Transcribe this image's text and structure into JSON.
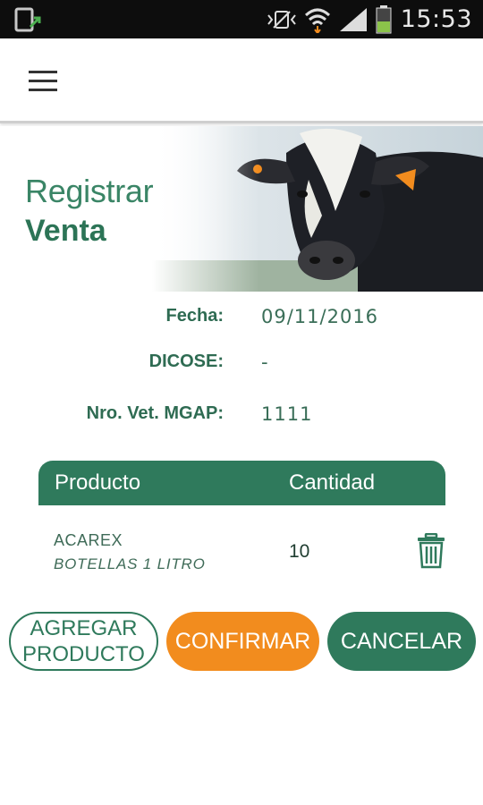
{
  "statusbar": {
    "time": "15:53"
  },
  "header": {
    "title_line1": "Registrar",
    "title_line2": "Venta"
  },
  "info": {
    "fecha_label": "Fecha:",
    "fecha_value": "09/11/2016",
    "dicose_label": "DICOSE:",
    "dicose_value": "-",
    "vet_label": "Nro. Vet. MGAP:",
    "vet_value": "1111"
  },
  "table": {
    "col_producto": "Producto",
    "col_cantidad": "Cantidad",
    "rows": [
      {
        "name": "ACAREX",
        "desc": "BOTELLAS 1 LITRO",
        "qty": "10"
      }
    ]
  },
  "actions": {
    "add_line1": "AGREGAR",
    "add_line2": "PRODUCTO",
    "confirm": "CONFIRMAR",
    "cancel": "CANCELAR"
  },
  "colors": {
    "primary": "#2f7a5c",
    "accent": "#f28c1e"
  }
}
